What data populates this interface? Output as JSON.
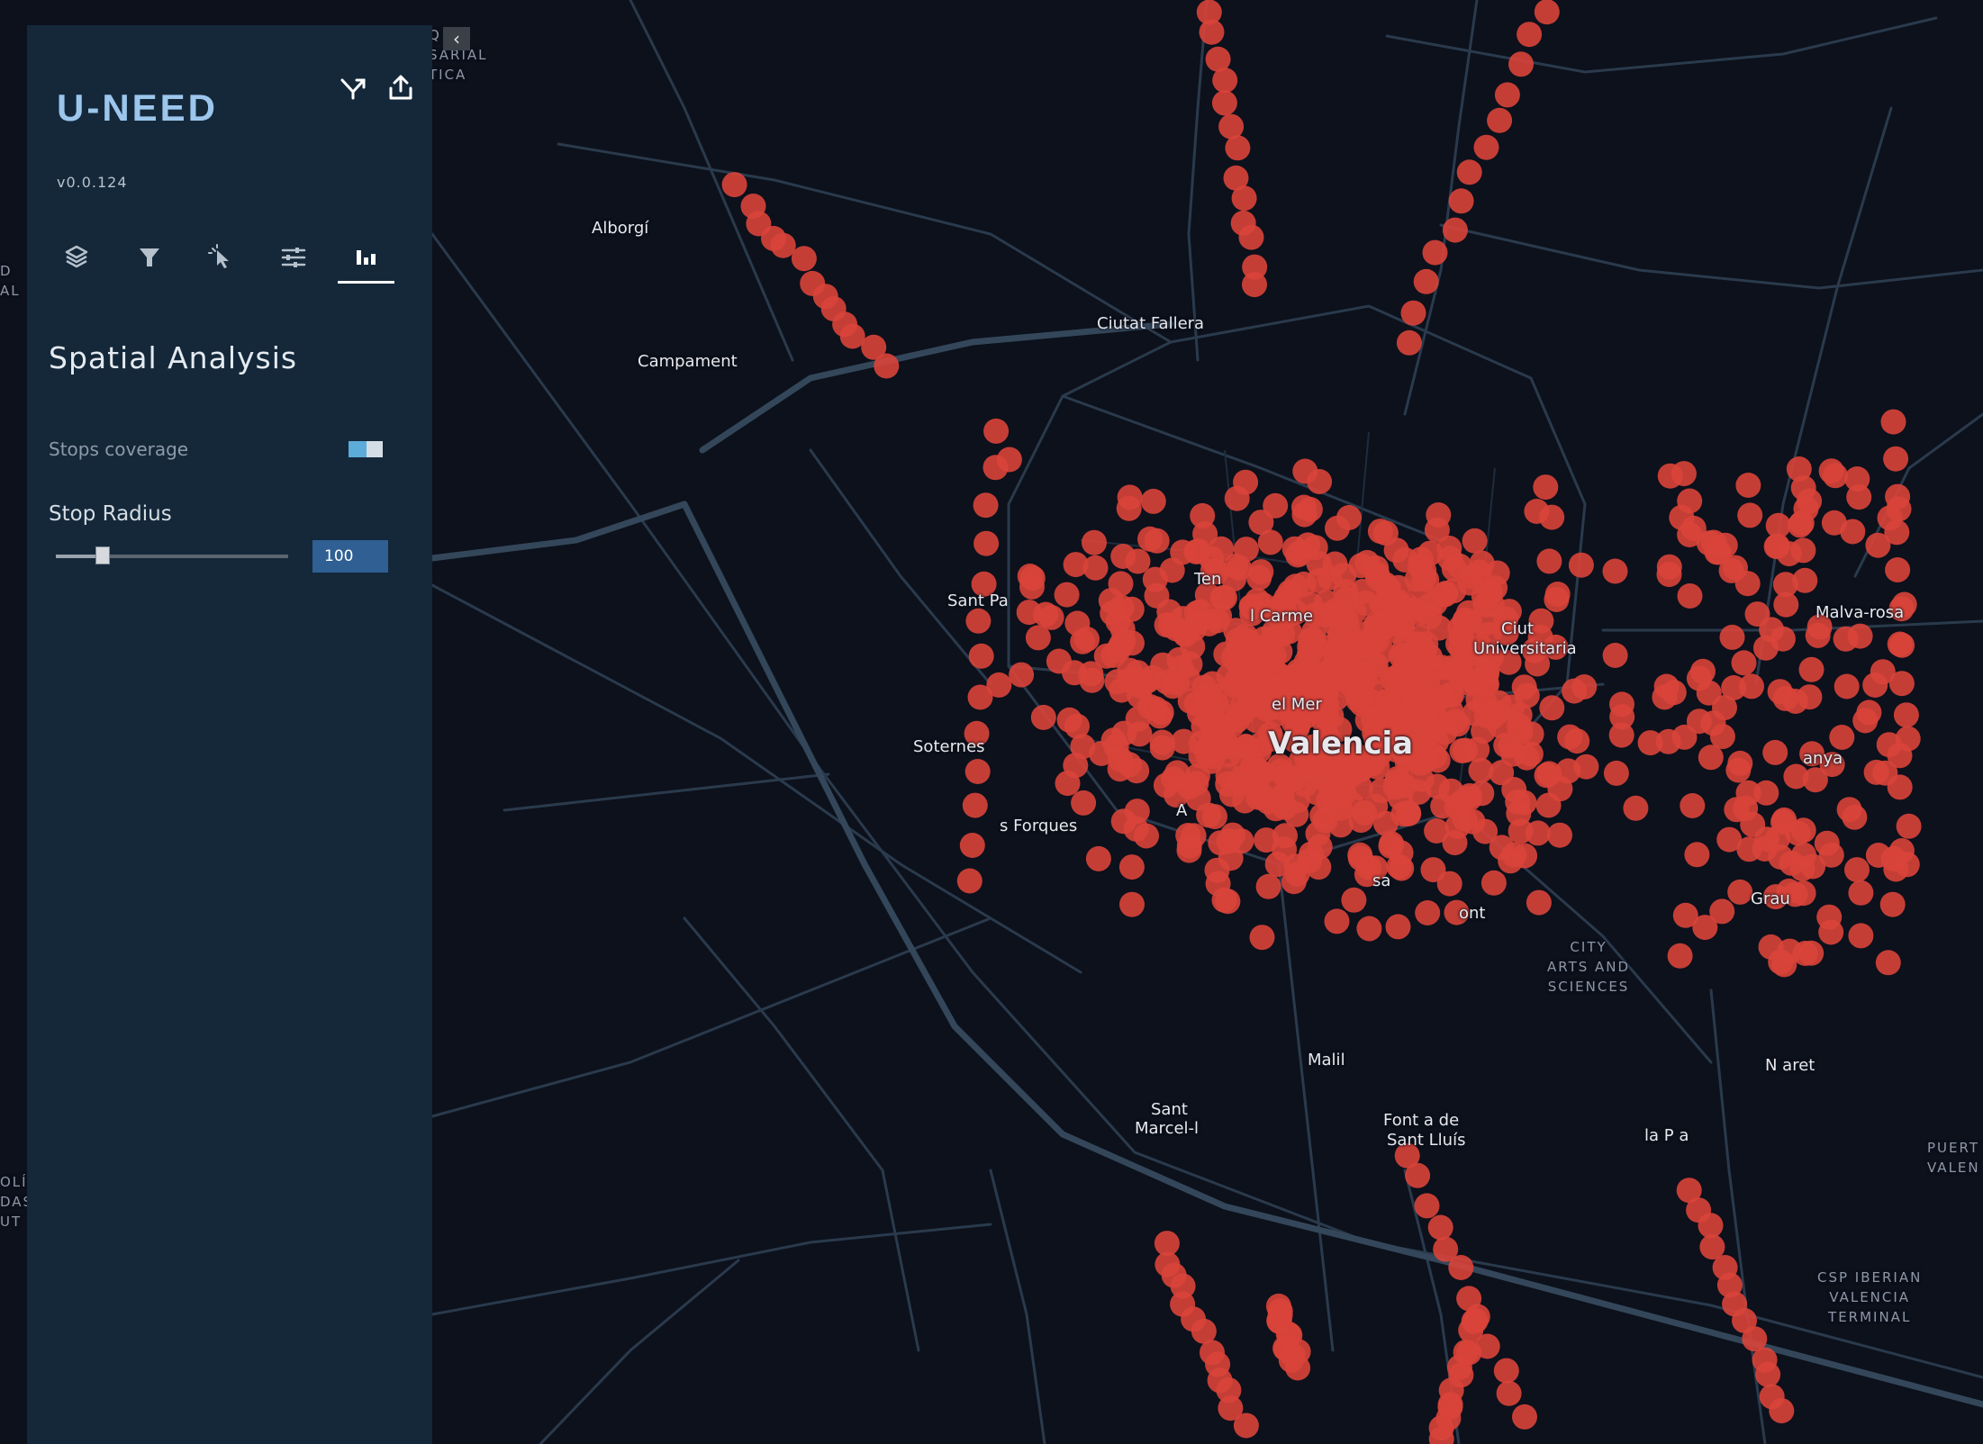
{
  "app": {
    "title": "U-NEED",
    "version": "v0.0.124"
  },
  "header_icons": [
    "share-icon",
    "export-icon"
  ],
  "tabs": [
    {
      "icon": "layers-icon",
      "active": false
    },
    {
      "icon": "filter-icon",
      "active": false
    },
    {
      "icon": "pointer-icon",
      "active": false
    },
    {
      "icon": "sliders-icon",
      "active": false
    },
    {
      "icon": "bar-chart-icon",
      "active": true
    }
  ],
  "panel": {
    "title": "Spatial Analysis",
    "toggle_label": "Stops coverage",
    "toggle_on": true,
    "radius_label": "Stop Radius",
    "radius_value": "100",
    "slider_fraction": 0.2
  },
  "collapse_glyph": "‹",
  "colors": {
    "map_background": "#0c111c",
    "road": "#2a3a4c",
    "road_major": "#34475a",
    "stop": "#d9443a",
    "sidebar": "#14283a",
    "accent": "#9cc6ec"
  },
  "map_labels": {
    "alborgi": "Alborgí",
    "campament": "Campament",
    "ciutat_fallera": "Ciutat Fallera",
    "sant_pau": "Sant Pa",
    "soternes": "Soternes",
    "les_forques": "s Forques",
    "tendetes": "Ten",
    "el_carme": "l Carme",
    "ciutat_universitaria_1": "Ciut",
    "ciutat_universitaria_2": "Universitaria",
    "el_mercat": "el Mer",
    "valencia": "Valencia",
    "malilla": "Malil",
    "sant_marcel_1": "Sant",
    "sant_marcel_2": "Marcel-l",
    "font_sant_lluis_1": "Font a de",
    "font_sant_lluis_2": "Sant Lluís",
    "la_punta": "la P a",
    "natzaret": "N aret",
    "grau": "Grau",
    "malva_rosa": "Malva-rosa",
    "ayora": "anya",
    "monteolivete": "ont",
    "russafa": "sa",
    "arrancapins": "A",
    "city_arts_1": "CITY",
    "city_arts_2": "ARTS AND",
    "city_arts_3": "SCIENCES",
    "puerto_1": "PUERT",
    "puerto_2": "VALEN",
    "csp_1": "CSP IBERIAN",
    "csp_2": "VALENCIA",
    "csp_3": "TERMINAL",
    "edge_top_1": "Q",
    "edge_top_2": "SARIAL",
    "edge_top_3": "TICA",
    "edge_left_1": "D",
    "edge_left_2": "AL",
    "edge_left_3": "OLÍC",
    "edge_left_4": "DAS",
    "edge_left_5": "UT"
  }
}
